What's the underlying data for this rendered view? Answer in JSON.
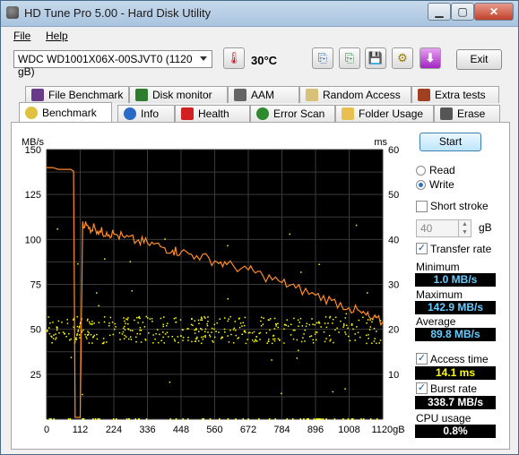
{
  "window": {
    "title": "HD Tune Pro 5.00 - Hard Disk Utility"
  },
  "menu": {
    "file": "File",
    "help": "Help"
  },
  "toolbar": {
    "drive": "WDC WD1001X06X-00SJVT0 (1120 gB)",
    "temperature": "30°C",
    "exit_label": "Exit"
  },
  "tabs_top": [
    {
      "label": "File Benchmark"
    },
    {
      "label": "Disk monitor"
    },
    {
      "label": "AAM"
    },
    {
      "label": "Random Access"
    },
    {
      "label": "Extra tests"
    }
  ],
  "tabs_bottom": [
    {
      "label": "Benchmark"
    },
    {
      "label": "Info"
    },
    {
      "label": "Health"
    },
    {
      "label": "Error Scan"
    },
    {
      "label": "Folder Usage"
    },
    {
      "label": "Erase"
    }
  ],
  "controls": {
    "start": "Start",
    "read": "Read",
    "write": "Write",
    "short_stroke": "Short stroke",
    "stroke_value": "40",
    "stroke_unit": "gB",
    "transfer_rate": "Transfer rate",
    "minimum_label": "Minimum",
    "minimum_value": "1.0 MB/s",
    "maximum_label": "Maximum",
    "maximum_value": "142.9 MB/s",
    "average_label": "Average",
    "average_value": "89.8 MB/s",
    "access_time": "Access time",
    "access_value": "14.1 ms",
    "burst_rate": "Burst rate",
    "burst_value": "338.7 MB/s",
    "cpu_label": "CPU usage",
    "cpu_value": "0.8%"
  },
  "chart_data": {
    "type": "line",
    "ylabel_left": "MB/s",
    "ylabel_right": "ms",
    "x_unit": "gB",
    "x_ticks": [
      "0",
      "112",
      "224",
      "336",
      "448",
      "560",
      "672",
      "784",
      "896",
      "1008",
      "1120gB"
    ],
    "y_left_ticks": [
      "150",
      "125",
      "100",
      "75",
      "50",
      "25"
    ],
    "y_right_ticks": [
      "60",
      "50",
      "40",
      "30",
      "20",
      "10"
    ],
    "ylim_left": [
      0,
      150
    ],
    "ylim_right": [
      0,
      60
    ],
    "xlim": [
      0,
      1120
    ],
    "grid": true,
    "series": [
      {
        "color": "#ff8c28",
        "x": [
          0,
          20,
          40,
          60,
          80,
          90,
          95,
          100,
          105,
          112,
          120,
          140,
          160,
          180,
          200,
          224,
          260,
          300,
          336,
          380,
          420,
          448,
          500,
          560,
          600,
          672,
          720,
          784,
          830,
          896,
          950,
          1008,
          1050,
          1080,
          1120
        ],
        "values": [
          140,
          140,
          139,
          139,
          139,
          138,
          1,
          1,
          1,
          1,
          110,
          106,
          107,
          104,
          104,
          103,
          101,
          99,
          98,
          96,
          94,
          93,
          91,
          88,
          86,
          83,
          80,
          76,
          73,
          69,
          66,
          62,
          59,
          56,
          54
        ]
      }
    ],
    "scatter_access_ms_band": [
      17,
      23
    ],
    "scatter_color": "#ffff00"
  }
}
